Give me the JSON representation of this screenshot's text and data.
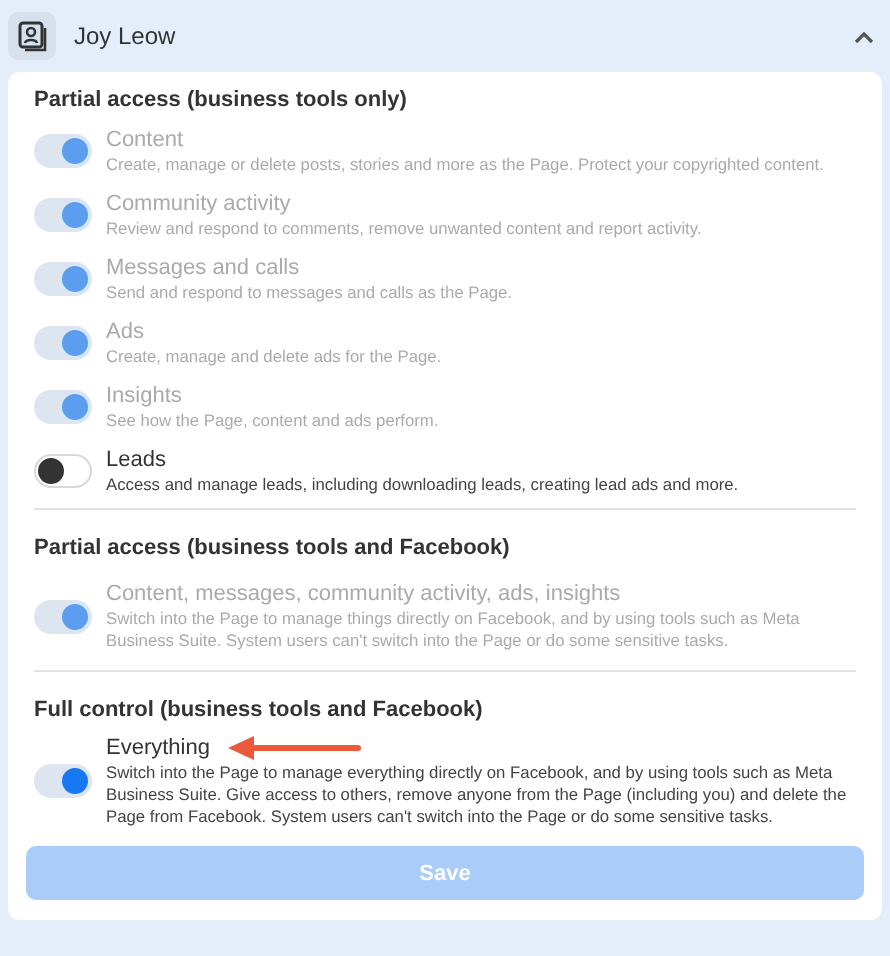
{
  "header": {
    "name": "Joy Leow",
    "expanded": true
  },
  "sections": [
    {
      "title": "Partial access (business tools only)",
      "items": [
        {
          "label": "Content",
          "description": "Create, manage or delete posts, stories and more as the Page. Protect your copyrighted content.",
          "on": true,
          "disabled": true
        },
        {
          "label": "Community activity",
          "description": "Review and respond to comments, remove unwanted content and report activity.",
          "on": true,
          "disabled": true
        },
        {
          "label": "Messages and calls",
          "description": "Send and respond to messages and calls as the Page.",
          "on": true,
          "disabled": true
        },
        {
          "label": "Ads",
          "description": "Create, manage and delete ads for the Page.",
          "on": true,
          "disabled": true
        },
        {
          "label": "Insights",
          "description": "See how the Page, content and ads perform.",
          "on": true,
          "disabled": true
        },
        {
          "label": "Leads",
          "description": "Access and manage leads, including downloading leads, creating lead ads and more.",
          "on": false,
          "disabled": false
        }
      ]
    },
    {
      "title": "Partial access (business tools and Facebook)",
      "items": [
        {
          "label": "Content, messages, community activity, ads, insights",
          "description": "Switch into the Page to manage things directly on Facebook, and by using tools such as Meta Business Suite. System users can't switch into the Page or do some sensitive tasks.",
          "on": true,
          "disabled": true
        }
      ]
    },
    {
      "title": "Full control (business tools and Facebook)",
      "items": [
        {
          "label": "Everything",
          "description": "Switch into the Page to manage everything directly on Facebook, and by using tools such as Meta Business Suite. Give access to others, remove anyone from the Page (including you) and delete the Page from Facebook. System users can't switch into the Page or do some sensitive tasks.",
          "on": true,
          "disabled": false,
          "annotated": true
        }
      ]
    }
  ],
  "save_button": {
    "label": "Save",
    "disabled": true
  }
}
